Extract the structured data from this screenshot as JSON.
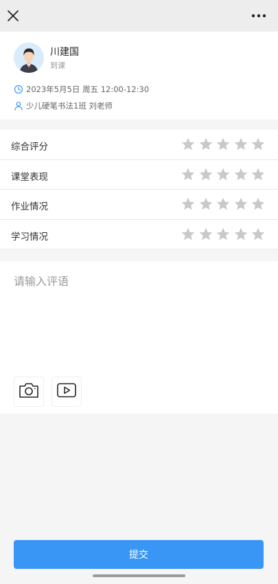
{
  "student": {
    "name": "川建国",
    "status": "到课"
  },
  "lesson": {
    "datetime": "2023年5月5日 周五 12:00-12:30",
    "class_teacher": "少儿硬笔书法1班 刘老师"
  },
  "ratings": [
    {
      "label": "综合评分",
      "stars": 0,
      "max": 5
    },
    {
      "label": "课堂表现",
      "stars": 0,
      "max": 5
    },
    {
      "label": "作业情况",
      "stars": 0,
      "max": 5
    },
    {
      "label": "学习情况",
      "stars": 0,
      "max": 5
    }
  ],
  "comment": {
    "placeholder": "请输入评语",
    "value": ""
  },
  "submit_label": "提交",
  "colors": {
    "accent": "#3a96f5",
    "star_empty": "#c9c9c9",
    "info_icon": "#3a96f5"
  }
}
